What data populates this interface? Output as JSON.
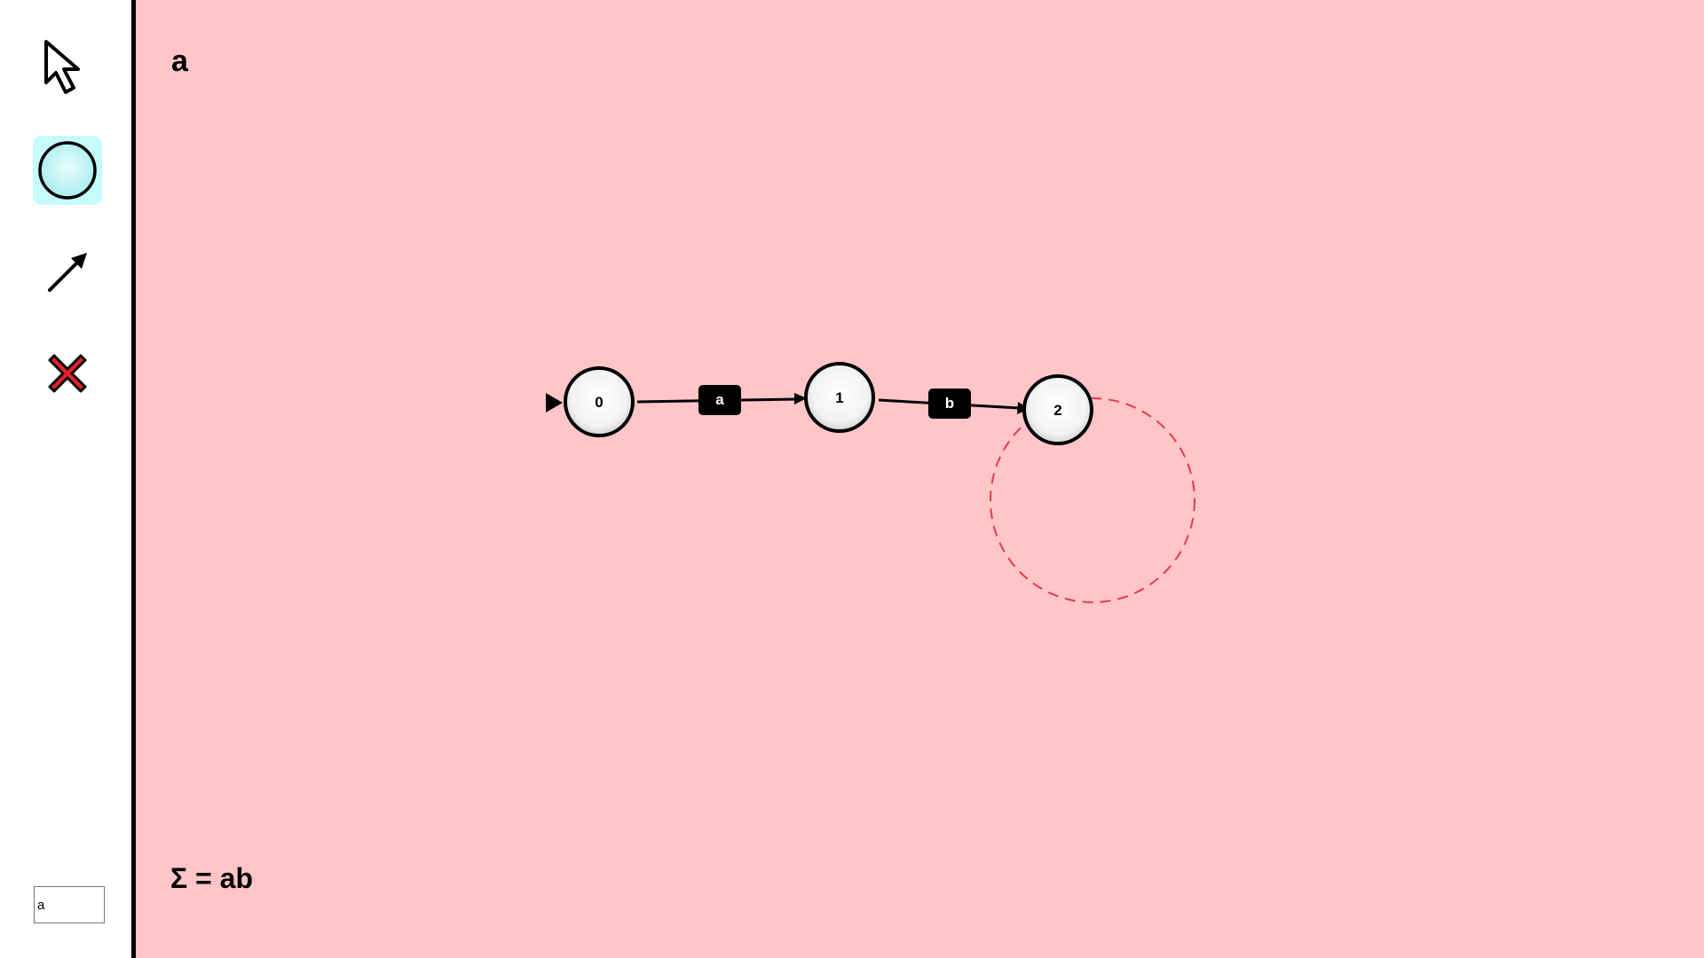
{
  "app": {
    "current_word": "a",
    "alphabet_prefix": "Σ = ",
    "alphabet": "ab"
  },
  "toolbar": {
    "tools": [
      {
        "name": "select",
        "icon": "cursor-arrow-icon",
        "active": false
      },
      {
        "name": "add-state",
        "icon": "circle-state-icon",
        "active": true
      },
      {
        "name": "add-transition",
        "icon": "arrow-icon",
        "active": false
      },
      {
        "name": "delete",
        "icon": "red-x-icon",
        "active": false
      }
    ],
    "symbol_input_value": "a"
  },
  "automaton": {
    "states": [
      {
        "id": "0",
        "label": "0",
        "initial": true
      },
      {
        "id": "1",
        "label": "1",
        "initial": false
      },
      {
        "id": "2",
        "label": "2",
        "initial": false
      }
    ],
    "transitions": [
      {
        "from": "0",
        "to": "1",
        "label": "a"
      },
      {
        "from": "1",
        "to": "2",
        "label": "b"
      }
    ],
    "highlight_color": "#e8394a"
  },
  "colors": {
    "canvas_bg": "#ffc5c7",
    "sidebar_bg": "#ffffff",
    "active_tool_bg": "#c6fbfb",
    "delete_red": "#e8202a"
  }
}
